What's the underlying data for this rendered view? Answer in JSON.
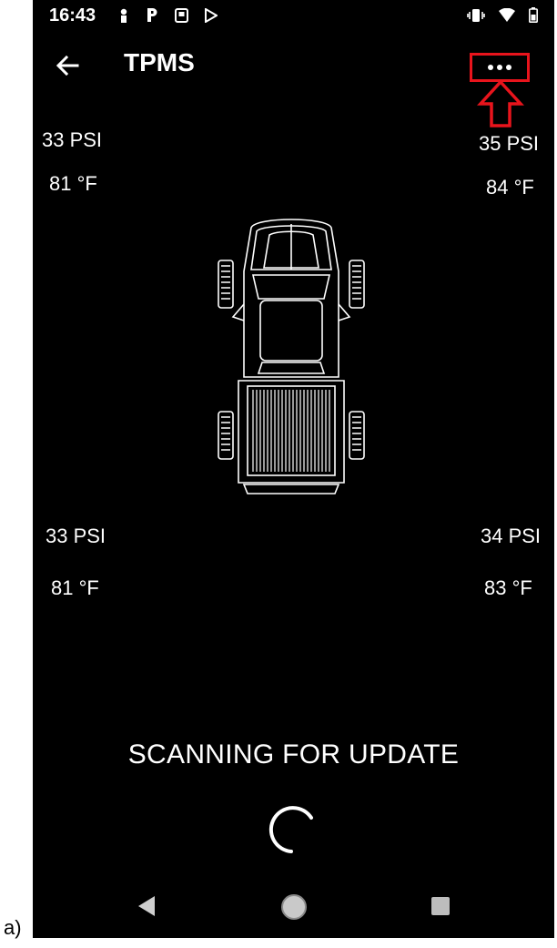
{
  "caption": "a)",
  "status_bar": {
    "time": "16:43"
  },
  "toolbar": {
    "title": "TPMS"
  },
  "tires": {
    "front_left": {
      "pressure": "33 PSI",
      "temperature": "81 °F"
    },
    "front_right": {
      "pressure": "35 PSI",
      "temperature": "84 °F"
    },
    "rear_left": {
      "pressure": "33 PSI",
      "temperature": "81 °F"
    },
    "rear_right": {
      "pressure": "34 PSI",
      "temperature": "83 °F"
    }
  },
  "status_message": "SCANNING FOR UPDATE",
  "colors": {
    "background": "#000000",
    "text": "#ffffff",
    "highlight": "#e8141c"
  },
  "icons": {
    "back": "arrow-left-icon",
    "menu": "more-horizontal-icon",
    "annotation": "arrow-up-icon",
    "vehicle": "pickup-truck-icon",
    "loading": "spinner-icon"
  }
}
